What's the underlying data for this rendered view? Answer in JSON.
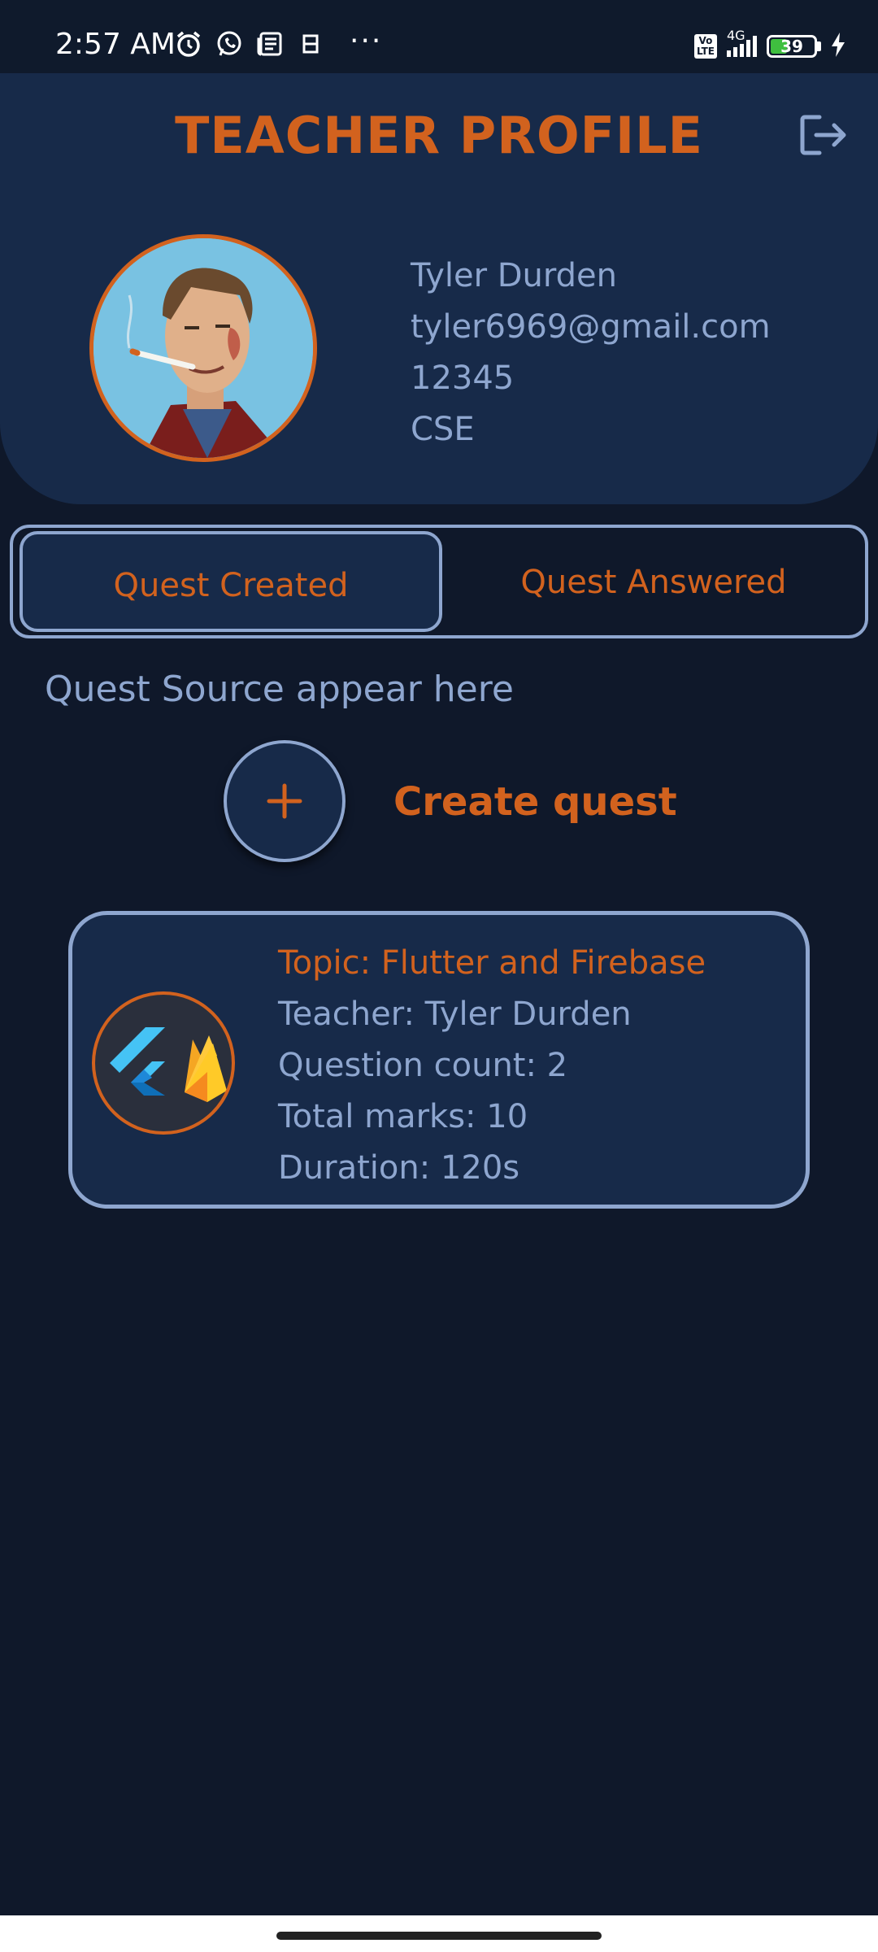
{
  "status_bar": {
    "time": "2:57 AM",
    "more": "···",
    "network": "4G",
    "volte_top": "Vo",
    "volte_bottom": "LTE",
    "battery": "39",
    "battery_level_percent": 39
  },
  "header": {
    "title": "TEACHER PROFILE"
  },
  "profile": {
    "name": "Tyler Durden",
    "email": "tyler6969@gmail.com",
    "id": "12345",
    "department": "CSE"
  },
  "tabs": [
    {
      "label": "Quest Created",
      "active": true
    },
    {
      "label": "Quest Answered",
      "active": false
    }
  ],
  "main": {
    "hint": "Quest Source appear here",
    "create_label": "Create quest"
  },
  "quest_card": {
    "topic": "Topic: Flutter and Firebase",
    "teacher": "Teacher: Tyler Durden",
    "question_count": "Question count: 2",
    "total_marks": "Total marks: 10",
    "duration": "Duration: 120s"
  },
  "colors": {
    "accent": "#d2621e",
    "text": "#8ea6cf",
    "surface": "#172a49",
    "background": "#0f182a"
  }
}
